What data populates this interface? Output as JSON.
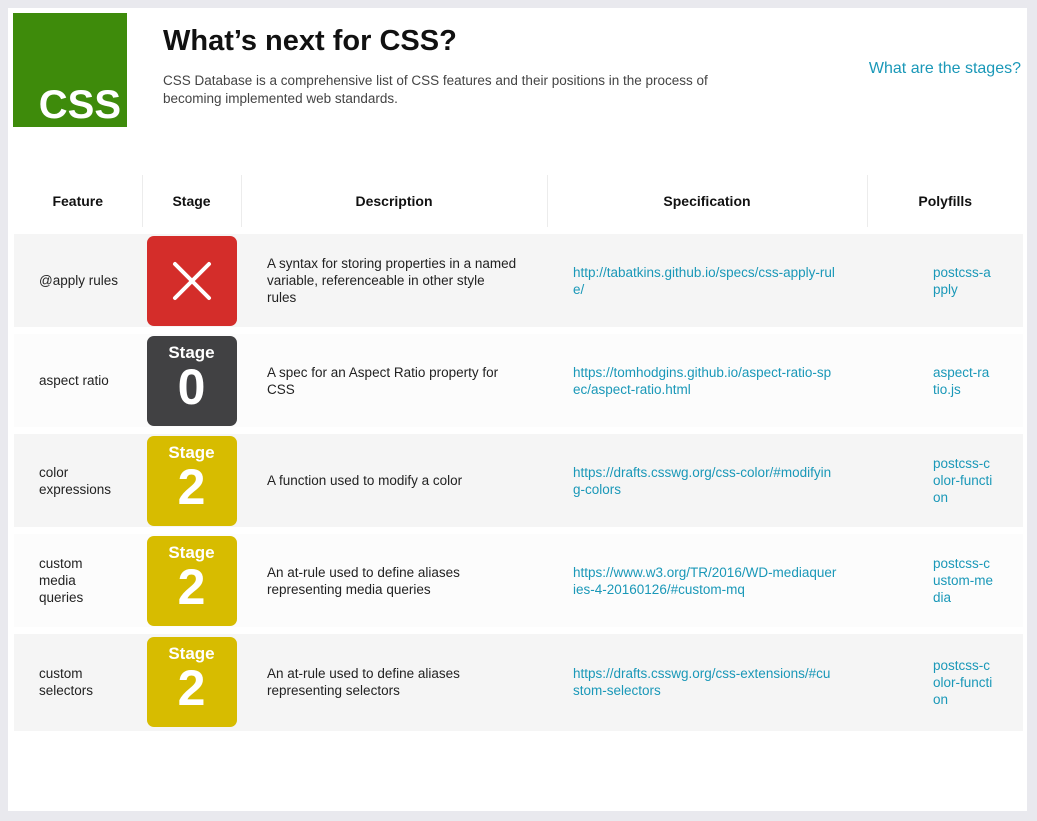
{
  "header": {
    "logo_text": "CSS",
    "title": "What’s next for CSS?",
    "description": "CSS Database is a comprehensive list of CSS features and their positions in the process of becoming implemented web standards.",
    "stages_link": "What are the stages?"
  },
  "colors": {
    "logo_green": "#3e8b0b",
    "link_blue": "#1a98b8",
    "stage_rejected_red": "#d42d2a",
    "stage_0_dark": "#414143",
    "stage_2_yellow": "#d7bc00"
  },
  "table": {
    "columns": [
      "Feature",
      "Stage",
      "Description",
      "Specification",
      "Polyfills"
    ],
    "rows": [
      {
        "feature": "@apply rules",
        "stage_label": "",
        "stage_number": "",
        "stage_icon": "close-icon",
        "description": "A syntax for storing properties in a named variable, referenceable in other style rules",
        "spec": "http://tabatkins.github.io/specs/css-apply-rule/",
        "polyfill": "postcss-apply"
      },
      {
        "feature": "aspect ratio",
        "stage_label": "Stage",
        "stage_number": "0",
        "description": "A spec for an Aspect Ratio property for CSS",
        "spec": "https://tomhodgins.github.io/aspect-ratio-spec/aspect-ratio.html",
        "polyfill": "aspect-ratio.js"
      },
      {
        "feature": "color expressions",
        "stage_label": "Stage",
        "stage_number": "2",
        "description": "A function used to modify a color",
        "spec": "https://drafts.csswg.org/css-color/#modifying-colors",
        "polyfill": "postcss-color-function"
      },
      {
        "feature": "custom media queries",
        "stage_label": "Stage",
        "stage_number": "2",
        "description": "An at-rule used to define aliases representing media queries",
        "spec": "https://www.w3.org/TR/2016/WD-mediaqueries-4-20160126/#custom-mq",
        "polyfill": "postcss-custom-media"
      },
      {
        "feature": "custom selectors",
        "stage_label": "Stage",
        "stage_number": "2",
        "description": "An at-rule used to define aliases representing selectors",
        "spec": "https://drafts.csswg.org/css-extensions/#custom-selectors",
        "polyfill": "postcss-color-function"
      }
    ]
  }
}
